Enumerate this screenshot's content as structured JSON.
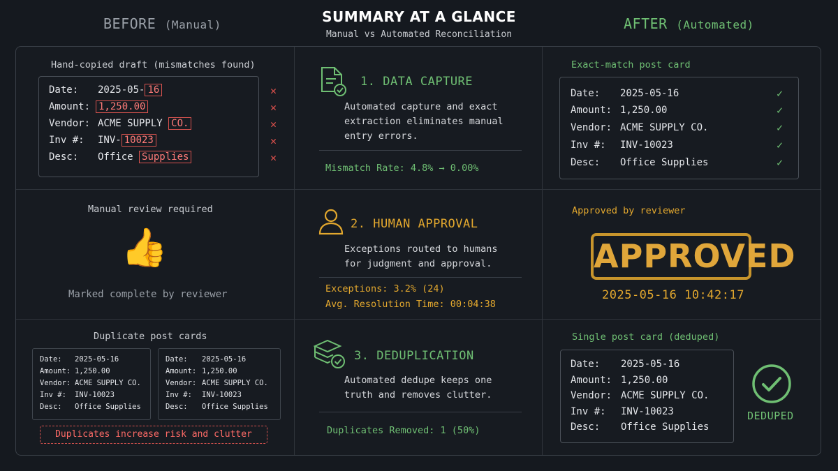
{
  "header": {
    "before_label": "BEFORE",
    "before_sub": "(Manual)",
    "title": "SUMMARY AT A GLANCE",
    "subtitle": "Manual vs Automated Reconciliation",
    "after_label": "AFTER",
    "after_sub": "(Automated)"
  },
  "row1": {
    "before": {
      "caption": "Hand-copied draft (mismatches found)",
      "fields": [
        {
          "label": "Date:",
          "prefix": "2025-05-",
          "highlight": "16"
        },
        {
          "label": "Amount:",
          "prefix": "",
          "highlight": "1,250.00"
        },
        {
          "label": "Vendor:",
          "prefix": "ACME SUPPLY ",
          "highlight": "CO."
        },
        {
          "label": "Inv #:",
          "prefix": "INV-",
          "highlight": "10023"
        },
        {
          "label": "Desc:",
          "prefix": "Office ",
          "highlight": "Supplies"
        }
      ],
      "status_icon": "x-mark-icon",
      "status_glyph": "✕"
    },
    "middle": {
      "icon": "document-check-icon",
      "title": "1. DATA CAPTURE",
      "desc_line1": "Automated capture and exact",
      "desc_line2": "extraction eliminates manual",
      "desc_line3": "entry errors.",
      "metric": "Mismatch Rate: 4.8% → 0.00%"
    },
    "after": {
      "caption": "Exact-match post card",
      "fields": [
        {
          "label": "Date:",
          "value": "2025-05-16"
        },
        {
          "label": "Amount:",
          "value": "1,250.00"
        },
        {
          "label": "Vendor:",
          "value": "ACME SUPPLY CO."
        },
        {
          "label": "Inv #:",
          "value": "INV-10023"
        },
        {
          "label": "Desc:",
          "value": "Office Supplies"
        }
      ],
      "status_glyph": "✓"
    }
  },
  "row2": {
    "before": {
      "caption": "Manual review required",
      "emoji": "👍",
      "note": "Marked complete by reviewer"
    },
    "middle": {
      "icon": "person-icon",
      "title": "2. HUMAN APPROVAL",
      "desc_line1": "Exceptions routed to humans",
      "desc_line2": "for judgment and approval.",
      "metric1": "Exceptions: 3.2% (24)",
      "metric2": "Avg. Resolution Time: 00:04:38"
    },
    "after": {
      "caption": "Approved by reviewer",
      "stamp": "APPROVED",
      "timestamp": "2025-05-16 10:42:17"
    }
  },
  "row3": {
    "before": {
      "caption": "Duplicate post cards",
      "cards": [
        {
          "rows": [
            {
              "label": "Date:",
              "value": "2025-05-16"
            },
            {
              "label": "Amount:",
              "value": "1,250.00"
            },
            {
              "label": "Vendor:",
              "value": "ACME SUPPLY CO."
            },
            {
              "label": "Inv #:",
              "value": "INV-10023"
            },
            {
              "label": "Desc:",
              "value": "Office Supplies"
            }
          ]
        },
        {
          "rows": [
            {
              "label": "Date:",
              "value": "2025-05-16"
            },
            {
              "label": "Amount:",
              "value": "1,250.00"
            },
            {
              "label": "Vendor:",
              "value": "ACME SUPPLY CO."
            },
            {
              "label": "Inv #:",
              "value": "INV-10023"
            },
            {
              "label": "Desc:",
              "value": "Office Supplies"
            }
          ]
        }
      ],
      "warning": "Duplicates increase risk and clutter"
    },
    "middle": {
      "icon": "stack-check-icon",
      "title": "3. DEDUPLICATION",
      "desc_line1": "Automated dedupe keeps one",
      "desc_line2": "truth and removes clutter.",
      "metric": "Duplicates Removed: 1 (50%)"
    },
    "after": {
      "caption": "Single post card (deduped)",
      "fields": [
        {
          "label": "Date:",
          "value": "2025-05-16"
        },
        {
          "label": "Amount:",
          "value": "1,250.00"
        },
        {
          "label": "Vendor:",
          "value": "ACME SUPPLY CO."
        },
        {
          "label": "Inv #:",
          "value": "INV-10023"
        },
        {
          "label": "Desc:",
          "value": "Office Supplies"
        }
      ],
      "badge": "DEDUPED"
    }
  },
  "colors": {
    "background": "#15191f",
    "green": "#6fbf73",
    "gold": "#e3a82e",
    "red": "#e0514d"
  }
}
